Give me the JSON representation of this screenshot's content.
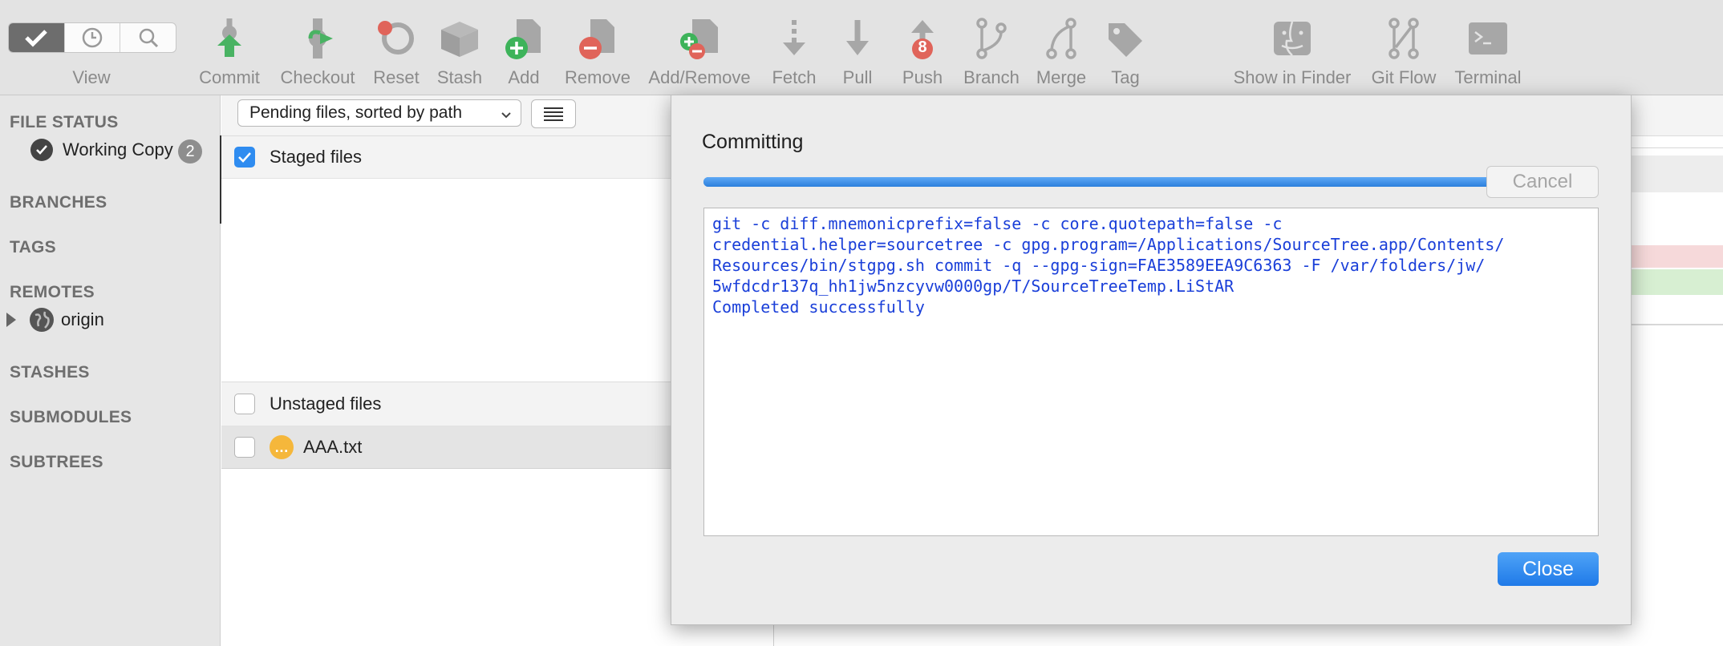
{
  "toolbar": {
    "view_label": "View",
    "tools": [
      {
        "label": "Commit",
        "icon": "commit-icon"
      },
      {
        "label": "Checkout",
        "icon": "checkout-icon"
      },
      {
        "label": "Reset",
        "icon": "reset-icon"
      },
      {
        "label": "Stash",
        "icon": "stash-icon"
      },
      {
        "label": "Add",
        "icon": "add-icon"
      },
      {
        "label": "Remove",
        "icon": "remove-icon"
      },
      {
        "label": "Add/Remove",
        "icon": "add-remove-icon"
      },
      {
        "label": "Fetch",
        "icon": "fetch-icon"
      },
      {
        "label": "Pull",
        "icon": "pull-icon"
      },
      {
        "label": "Push",
        "icon": "push-icon",
        "badge": "8"
      },
      {
        "label": "Branch",
        "icon": "branch-icon"
      },
      {
        "label": "Merge",
        "icon": "merge-icon"
      },
      {
        "label": "Tag",
        "icon": "tag-icon"
      },
      {
        "label": "Show in Finder",
        "icon": "finder-icon"
      },
      {
        "label": "Git Flow",
        "icon": "git-flow-icon"
      },
      {
        "label": "Terminal",
        "icon": "terminal-icon"
      }
    ]
  },
  "sidebar": {
    "file_status": "FILE STATUS",
    "working_copy": "Working Copy",
    "working_copy_count": "2",
    "branches": "BRANCHES",
    "tags": "TAGS",
    "remotes": "REMOTES",
    "origin": "origin",
    "stashes": "STASHES",
    "submodules": "SUBMODULES",
    "subtrees": "SUBTREES"
  },
  "files": {
    "sort_value": "Pending files, sorted by path",
    "staged_label": "Staged files",
    "unstaged_label": "Unstaged files",
    "unstaged": [
      {
        "name": "AAA.txt"
      }
    ]
  },
  "dialog": {
    "title": "Committing",
    "progress": 1.0,
    "cancel_label": "Cancel",
    "close_label": "Close",
    "log": "git -c diff.mnemonicprefix=false -c core.quotepath=false -c\ncredential.helper=sourcetree -c gpg.program=/Applications/SourceTree.app/Contents/\nResources/bin/stgpg.sh commit -q --gpg-sign=FAE3589EEA9C6363 -F /var/folders/jw/\n5wfdcdr137q_hh1jw5nzcyvw0000gp/T/SourceTreeTemp.LiStAR\nCompleted successfully"
  },
  "colors": {
    "accent": "#2f8cf0",
    "log_text": "#1a3fd9",
    "add_green": "#3db35a",
    "remove_red": "#e0645a",
    "push_badge": "#e0645a"
  }
}
